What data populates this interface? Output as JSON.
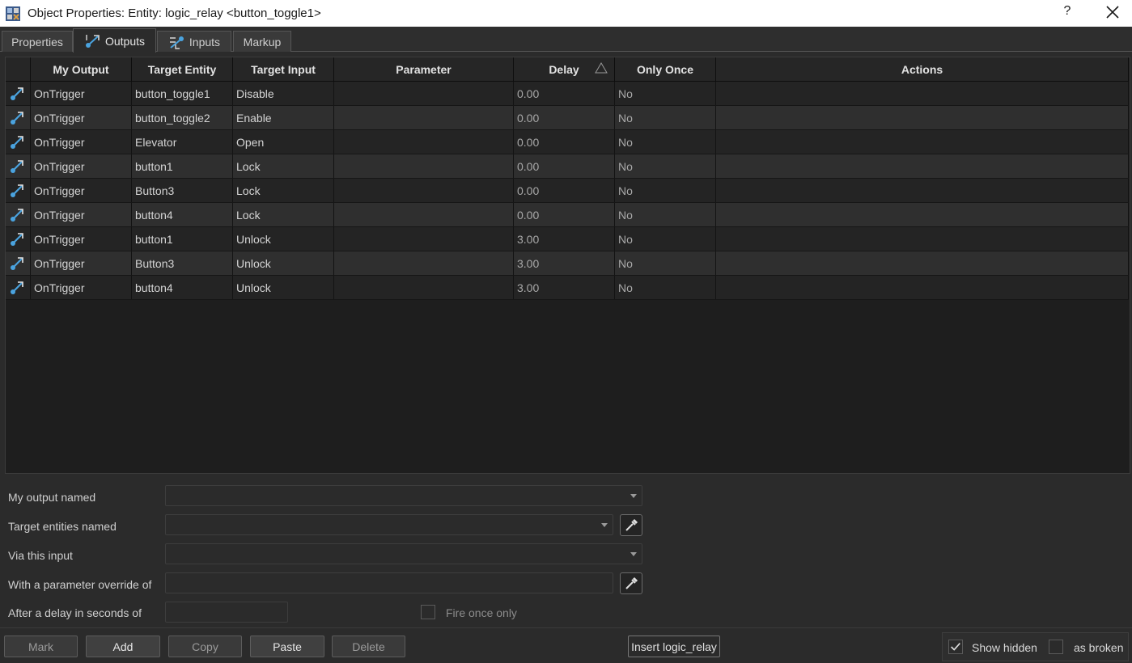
{
  "window": {
    "title": "Object Properties: Entity: logic_relay <button_toggle1>",
    "help_label": "?"
  },
  "tabs": [
    {
      "label": "Properties"
    },
    {
      "label": "Outputs"
    },
    {
      "label": "Inputs"
    },
    {
      "label": "Markup"
    }
  ],
  "grid": {
    "columns": [
      "My Output",
      "Target Entity",
      "Target Input",
      "Parameter",
      "Delay",
      "Only Once",
      "Actions"
    ],
    "sorted_by": "Delay",
    "sort_direction": "ascending",
    "rows": [
      {
        "output": "OnTrigger",
        "target": "button_toggle1",
        "input": "Disable",
        "parameter": "",
        "delay": "0.00",
        "once": "No",
        "actions": ""
      },
      {
        "output": "OnTrigger",
        "target": "button_toggle2",
        "input": "Enable",
        "parameter": "",
        "delay": "0.00",
        "once": "No",
        "actions": ""
      },
      {
        "output": "OnTrigger",
        "target": "Elevator",
        "input": "Open",
        "parameter": "",
        "delay": "0.00",
        "once": "No",
        "actions": ""
      },
      {
        "output": "OnTrigger",
        "target": "button1",
        "input": "Lock",
        "parameter": "",
        "delay": "0.00",
        "once": "No",
        "actions": ""
      },
      {
        "output": "OnTrigger",
        "target": "Button3",
        "input": "Lock",
        "parameter": "",
        "delay": "0.00",
        "once": "No",
        "actions": ""
      },
      {
        "output": "OnTrigger",
        "target": "button4",
        "input": "Lock",
        "parameter": "",
        "delay": "0.00",
        "once": "No",
        "actions": ""
      },
      {
        "output": "OnTrigger",
        "target": "button1",
        "input": "Unlock",
        "parameter": "",
        "delay": "3.00",
        "once": "No",
        "actions": ""
      },
      {
        "output": "OnTrigger",
        "target": "Button3",
        "input": "Unlock",
        "parameter": "",
        "delay": "3.00",
        "once": "No",
        "actions": ""
      },
      {
        "output": "OnTrigger",
        "target": "button4",
        "input": "Unlock",
        "parameter": "",
        "delay": "3.00",
        "once": "No",
        "actions": ""
      }
    ]
  },
  "form": {
    "output_label": "My output named",
    "output_value": "",
    "target_label": "Target entities named",
    "target_value": "",
    "input_label": "Via this input",
    "input_value": "",
    "param_label": "With a parameter override of",
    "param_value": "",
    "delay_label": "After a delay in seconds of",
    "delay_value": "",
    "fire_once_label": "Fire once only",
    "fire_once_checked": false
  },
  "buttons": {
    "mark": "Mark",
    "add": "Add",
    "copy": "Copy",
    "paste": "Paste",
    "delete": "Delete",
    "insert": "Insert logic_relay"
  },
  "options": {
    "show_hidden_label": "Show hidden",
    "show_hidden_checked": true,
    "as_broken_label": "as broken",
    "as_broken_checked": false
  },
  "colors": {
    "accent_icon": "#4aa3df",
    "background": "#2b2b2b",
    "row_odd": "#242424",
    "row_even": "#2f2f2f"
  },
  "icons": {
    "row_icon": "output-connection-icon",
    "outputs_tab_icon": "outputs-icon",
    "inputs_tab_icon": "inputs-icon",
    "picker_icon": "eyedropper-icon"
  }
}
